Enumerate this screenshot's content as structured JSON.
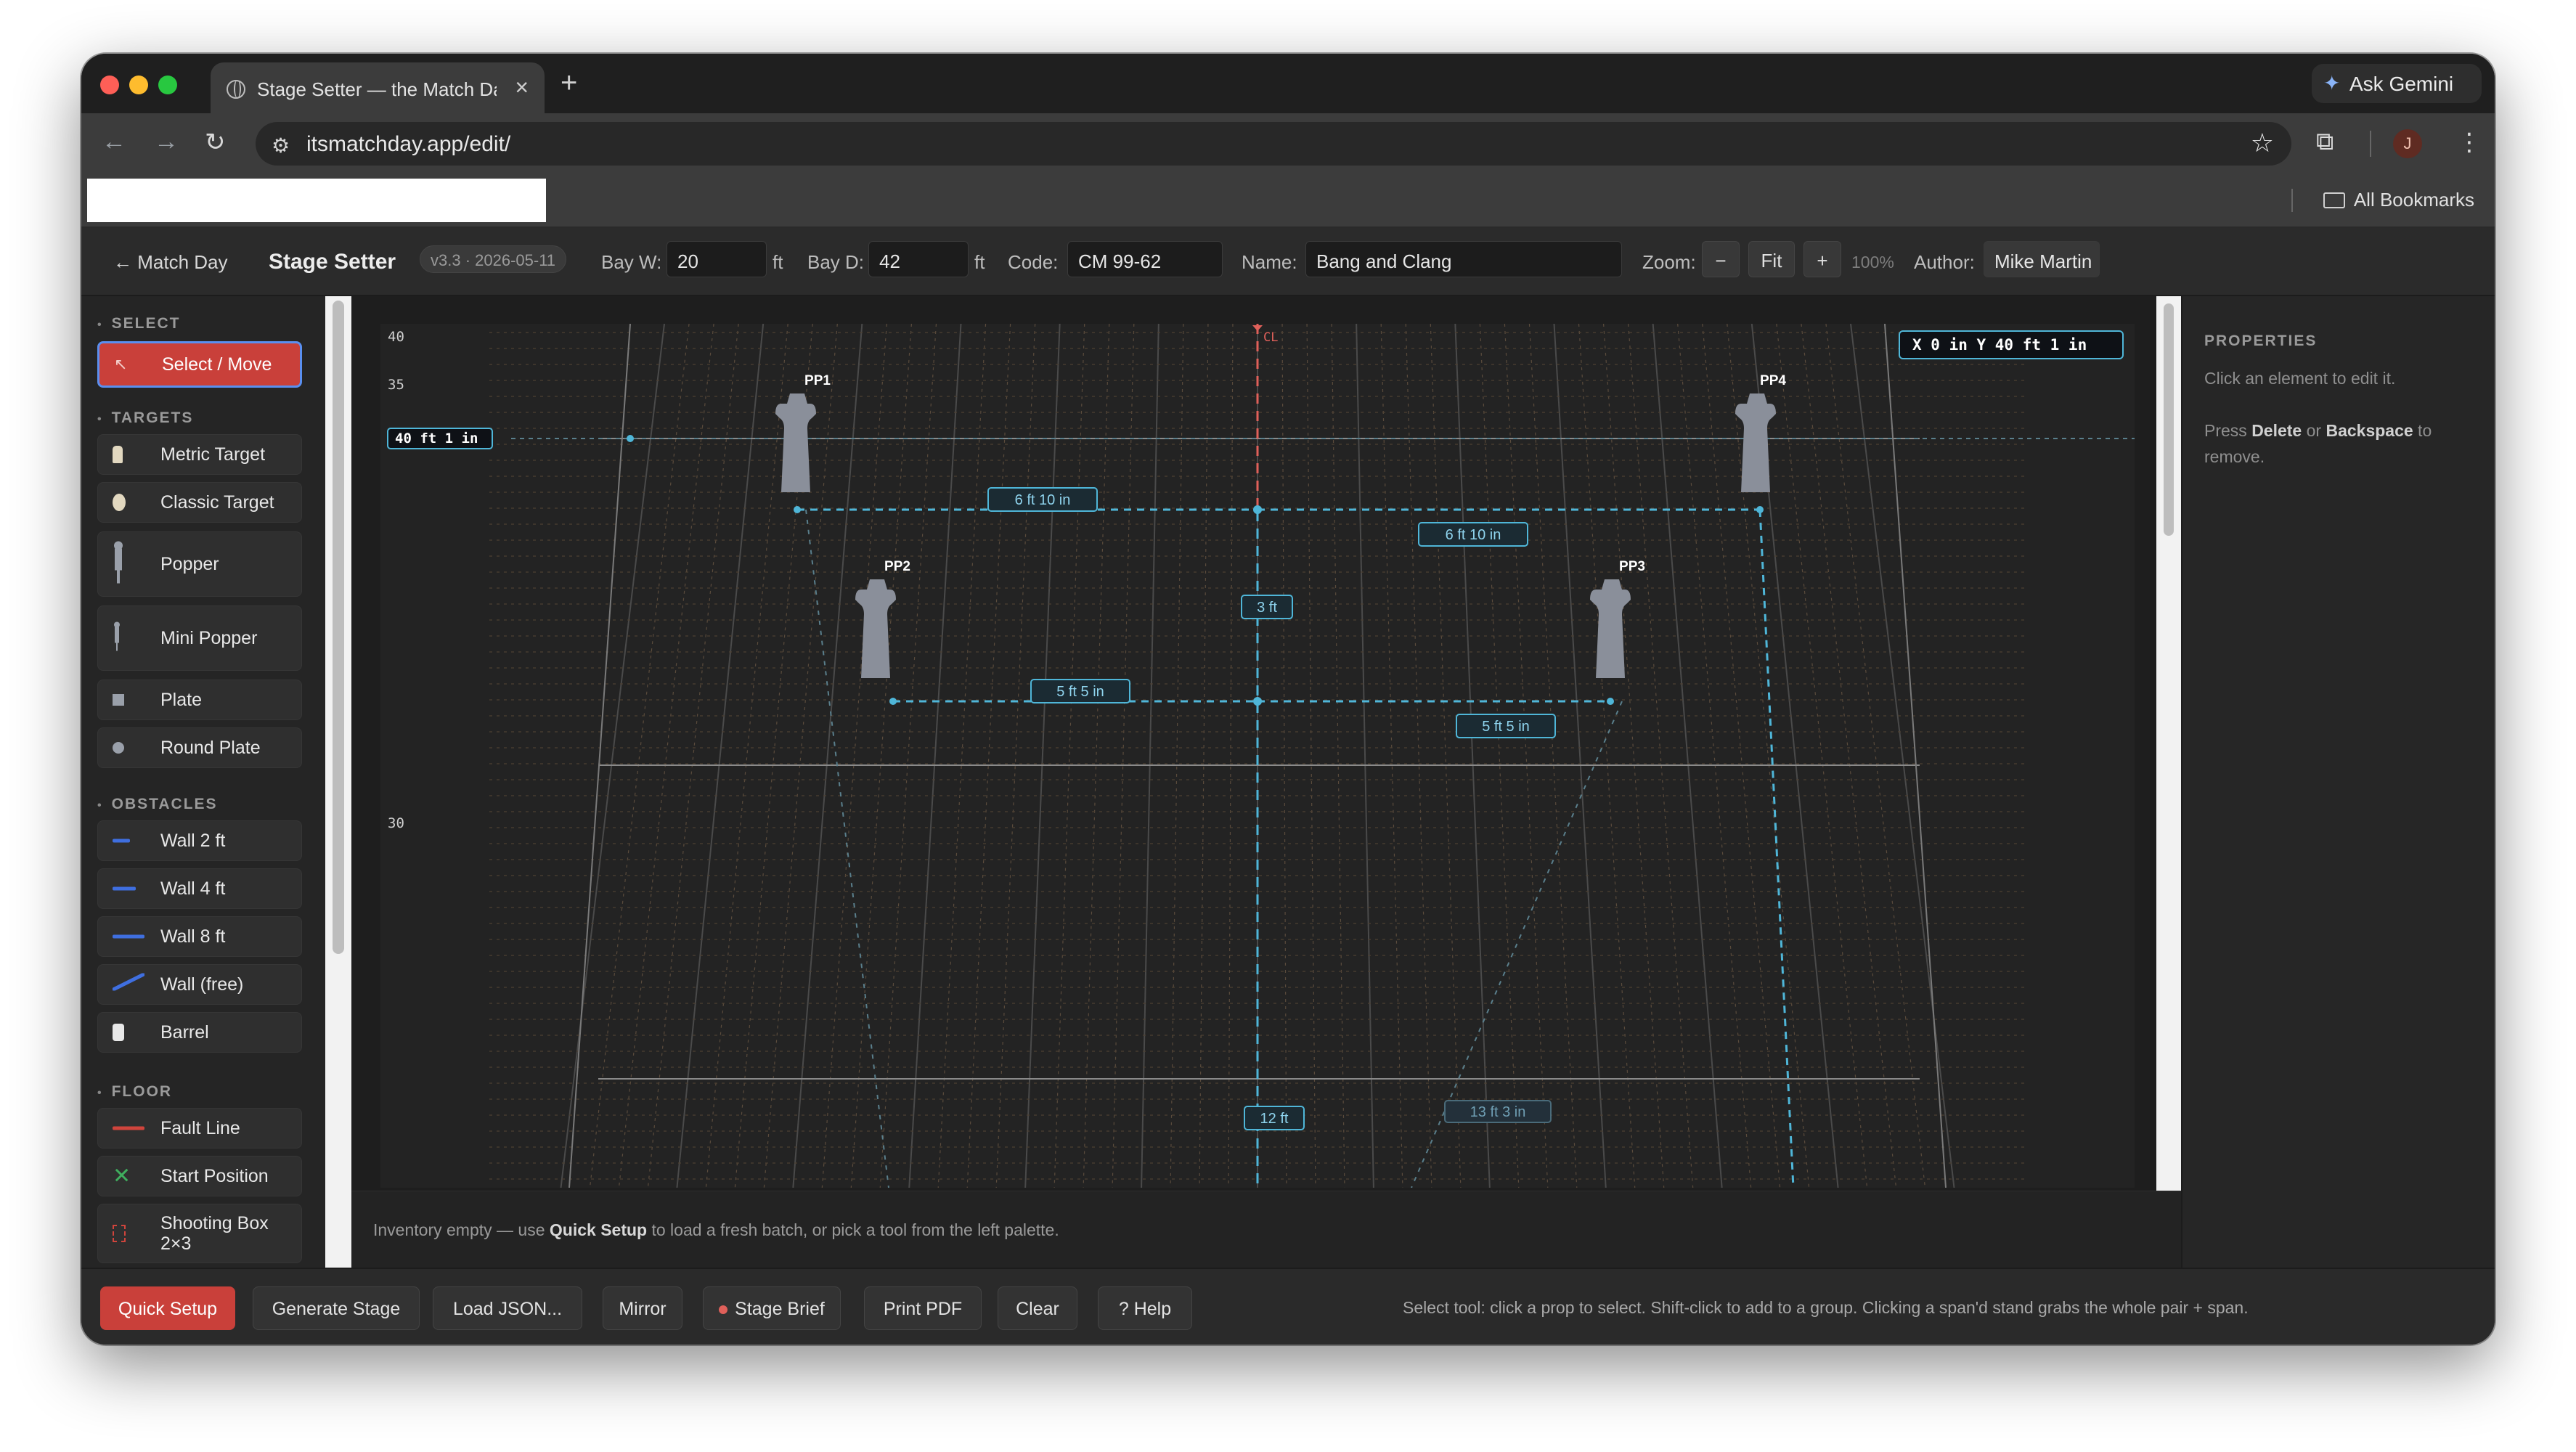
{
  "browser": {
    "tab_title": "Stage Setter — the Match Day",
    "new_tab": "+",
    "close_tab": "×",
    "ask_gemini": "Ask Gemini",
    "url": "itsmatchday.app/edit/",
    "all_bookmarks": "All Bookmarks",
    "avatar_initial": "J"
  },
  "header": {
    "back_link": "← Match Day",
    "app_title": "Stage Setter",
    "version": "v3.3 · 2026-05-11",
    "bay_w_label": "Bay W:",
    "bay_w_value": "20",
    "bay_w_unit": "ft",
    "bay_d_label": "Bay D:",
    "bay_d_value": "42",
    "bay_d_unit": "ft",
    "code_label": "Code:",
    "code_value": "CM 99-62",
    "name_label": "Name:",
    "name_value": "Bang and Clang",
    "zoom_label": "Zoom:",
    "zoom_minus": "−",
    "zoom_fit": "Fit",
    "zoom_plus": "+",
    "zoom_level": "100%",
    "author_label": "Author:",
    "author_value": "Mike Martin"
  },
  "sidebar": {
    "sections": {
      "select": "SELECT",
      "targets": "TARGETS",
      "obstacles": "OBSTACLES",
      "floor": "FLOOR"
    },
    "tools": {
      "select_move": "Select / Move",
      "metric_target": "Metric Target",
      "classic_target": "Classic Target",
      "popper": "Popper",
      "mini_popper": "Mini Popper",
      "plate": "Plate",
      "round_plate": "Round Plate",
      "wall_2": "Wall 2 ft",
      "wall_4": "Wall 4 ft",
      "wall_8": "Wall 8 ft",
      "wall_free": "Wall (free)",
      "barrel": "Barrel",
      "fault_line": "Fault Line",
      "start_position": "Start Position",
      "shooting_box_1": "Shooting Box",
      "shooting_box_2": "2×3"
    }
  },
  "stage": {
    "ruler": {
      "r40": "40",
      "r35": "35",
      "r30": "30"
    },
    "centerline_label": "CL",
    "coord_readout": "X 0 in Y 40 ft 1 in",
    "y_marker": "40 ft 1 in",
    "targets": {
      "pp1": "PP1",
      "pp2": "PP2",
      "pp3": "PP3",
      "pp4": "PP4"
    },
    "dimensions": {
      "d1": "6 ft 10 in",
      "d2": "6 ft 10 in",
      "d3": "3 ft",
      "d4": "5 ft 5 in",
      "d5": "5 ft 5 in",
      "d6": "12 ft",
      "d7": "13 ft 3 in"
    },
    "colors": {
      "grid": "#3a3a3a",
      "dim_line": "#4fb6d8",
      "centerline": "#e0605a",
      "popper": "#8a8f9a"
    }
  },
  "status": {
    "pre": "Inventory empty — use ",
    "bold": "Quick Setup",
    "post": " to load a fresh batch, or pick a tool from the left palette."
  },
  "properties": {
    "title": "PROPERTIES",
    "line1": "Click an element to edit it.",
    "line2_pre": "Press ",
    "line2_b1": "Delete",
    "line2_mid": " or ",
    "line2_b2": "Backspace",
    "line2_post": " to",
    "line3": "remove."
  },
  "bottom": {
    "quick_setup": "Quick Setup",
    "generate_stage": "Generate Stage",
    "load_json": "Load JSON...",
    "mirror": "Mirror",
    "stage_brief": "Stage Brief",
    "print_pdf": "Print PDF",
    "clear": "Clear",
    "help": "? Help",
    "hint": "Select tool: click a prop to select. Shift-click to add to a group. Clicking a span'd stand grabs the whole pair + span."
  }
}
